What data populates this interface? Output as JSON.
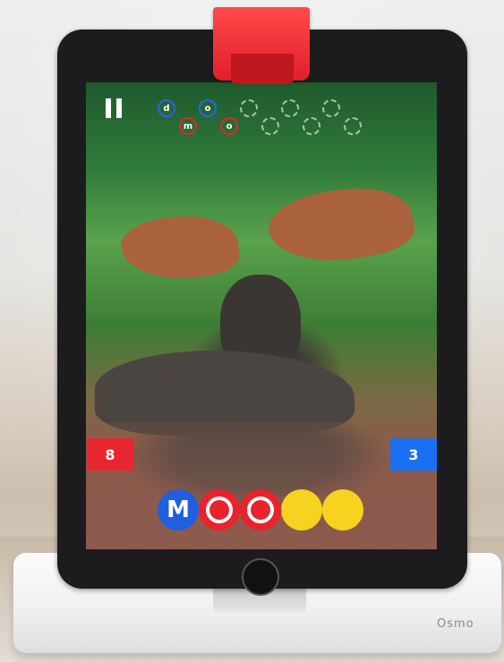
{
  "colors": {
    "team_left": "#e82530",
    "team_right": "#1a6ff0",
    "tile_blue": "#1f5fe0",
    "tile_red": "#e8232c",
    "tile_yellow": "#f7d21e",
    "slot_blue": "#2a63e6",
    "slot_red": "#e4252c"
  },
  "hud": {
    "pause_icon": "pause-icon",
    "slots": [
      {
        "row": "top",
        "color": "blue",
        "letter": "d"
      },
      {
        "row": "bottom",
        "color": "red",
        "letter": "m"
      },
      {
        "row": "top",
        "color": "blue",
        "letter": "o"
      },
      {
        "row": "bottom",
        "color": "red",
        "letter": "o"
      },
      {
        "row": "top",
        "color": "empty",
        "letter": ""
      },
      {
        "row": "bottom",
        "color": "empty",
        "letter": ""
      },
      {
        "row": "top",
        "color": "empty",
        "letter": ""
      },
      {
        "row": "bottom",
        "color": "empty",
        "letter": ""
      },
      {
        "row": "top",
        "color": "empty",
        "letter": ""
      },
      {
        "row": "bottom",
        "color": "empty",
        "letter": ""
      }
    ]
  },
  "scores": {
    "left": "8",
    "right": "3"
  },
  "tiles": [
    {
      "color": "blue",
      "letter": "M"
    },
    {
      "color": "red",
      "letter": ""
    },
    {
      "color": "red",
      "letter": ""
    },
    {
      "color": "yellow",
      "letter": ""
    },
    {
      "color": "yellow",
      "letter": ""
    }
  ],
  "stand": {
    "brand": "Osmo"
  }
}
